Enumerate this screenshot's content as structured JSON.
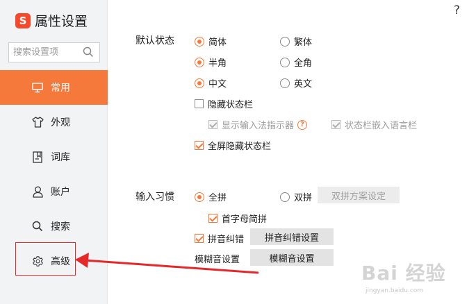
{
  "window": {
    "title": "属性设置",
    "help": "?"
  },
  "search": {
    "placeholder": "搜索设置项"
  },
  "sidebar": {
    "items": [
      {
        "label": "常用",
        "icon": "monitor-icon",
        "active": true
      },
      {
        "label": "外观",
        "icon": "shirt-icon",
        "active": false
      },
      {
        "label": "词库",
        "icon": "book-icon",
        "active": false
      },
      {
        "label": "账户",
        "icon": "user-icon",
        "active": false
      },
      {
        "label": "搜索",
        "icon": "search-icon",
        "active": false
      },
      {
        "label": "高级",
        "icon": "gear-icon",
        "active": false
      }
    ]
  },
  "default_state": {
    "title": "默认状态",
    "simplified": "简体",
    "traditional": "繁体",
    "half_width": "半角",
    "full_width": "全角",
    "chinese": "中文",
    "english": "英文",
    "hide_status_bar": "隐藏状态栏",
    "show_indicator": "显示输入法指示器",
    "embed_language_bar": "状态栏嵌入语言栏",
    "fullscreen_hide": "全屏隐藏状态栏"
  },
  "input_habit": {
    "title": "输入习惯",
    "full_pinyin": "全拼",
    "double_pinyin": "双拼",
    "double_scheme_button": "双拼方案设定",
    "initial_abbrev": "首字母简拼",
    "pinyin_correction": "拼音纠错",
    "correction_settings_button": "拼音纠错设置",
    "fuzzy_label": "模糊音设置",
    "fuzzy_button": "模糊音设置"
  },
  "watermark": {
    "text": "Bai 经验",
    "sub": "jingyan.baidu.com"
  },
  "colors": {
    "accent": "#f5793b",
    "logo": "#f6492c",
    "annotation": "#e5292a"
  }
}
